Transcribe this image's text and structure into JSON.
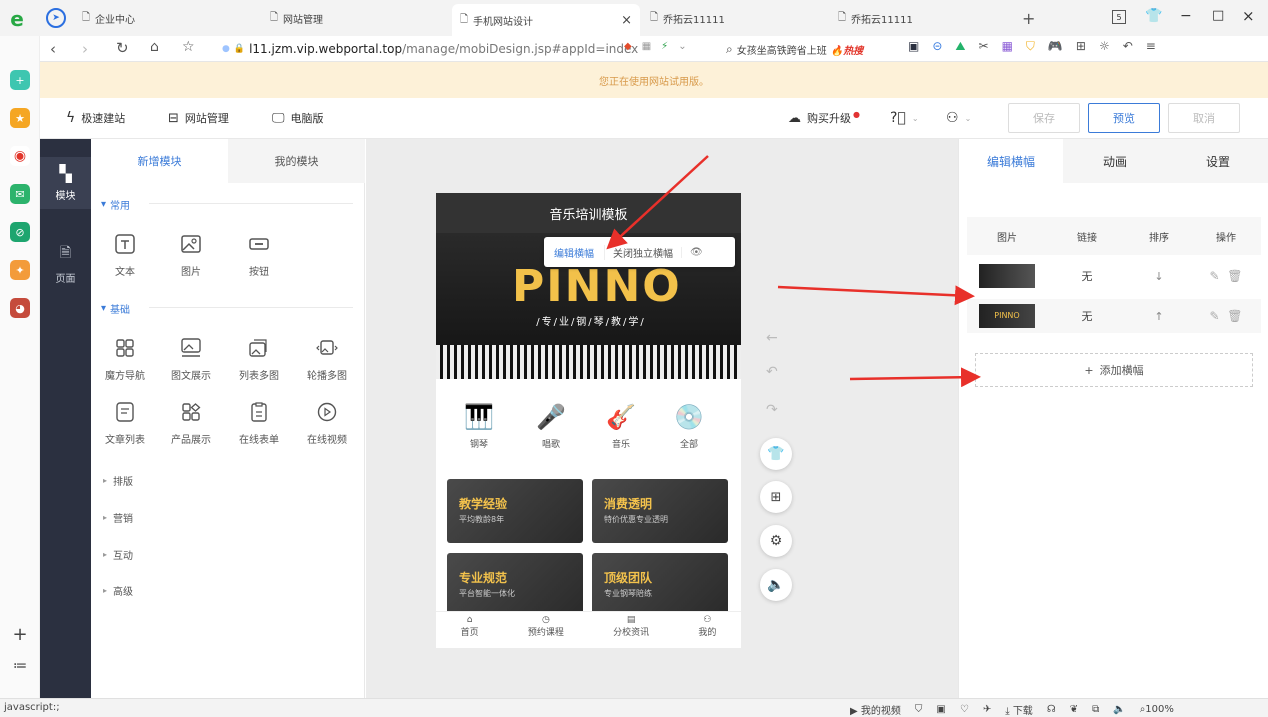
{
  "browser": {
    "tabs": [
      {
        "label": "企业中心"
      },
      {
        "label": "网站管理"
      },
      {
        "label": "手机网站设计",
        "close": "×"
      },
      {
        "label": "乔拓云11111"
      },
      {
        "label": "乔拓云11111"
      }
    ],
    "new_tab": "+",
    "window_controls": [
      "5",
      "−",
      "□",
      "×"
    ],
    "url_domain": "l11.jzm.vip.webportal.top",
    "url_path": "/manage/mobiDesign.jsp#appId=index",
    "search_text": "女孩坐高铁跨省上班",
    "hot_label": "热搜",
    "notice": "您正在使用网站试用版。"
  },
  "toolbar": {
    "items": [
      "极速建站",
      "网站管理",
      "电脑版"
    ],
    "buy": "购买升级",
    "save": "保存",
    "preview": "预览",
    "cancel": "取消"
  },
  "leftnav": {
    "items": [
      {
        "label": "模块"
      },
      {
        "label": "页面"
      }
    ]
  },
  "modules": {
    "tabs": [
      "新增模块",
      "我的模块"
    ],
    "sections": [
      {
        "title": "常用",
        "items": [
          "文本",
          "图片",
          "按钮"
        ]
      },
      {
        "title": "基础",
        "items": [
          "魔方导航",
          "图文展示",
          "列表多图",
          "轮播多图",
          "文章列表",
          "产品展示",
          "在线表单",
          "在线视频"
        ]
      }
    ],
    "categories": [
      "排版",
      "营销",
      "互动",
      "高级"
    ]
  },
  "phone": {
    "title": "音乐培训模板",
    "banner_popup": {
      "edit": "编辑横幅",
      "close": "关闭独立横幅"
    },
    "logo": "PINNO",
    "slogan": "/专/业/钢/琴/教/学/",
    "categories": [
      "钢琴",
      "唱歌",
      "音乐",
      "全部"
    ],
    "cards": [
      {
        "title": "教学经验",
        "sub": "平均教龄8年"
      },
      {
        "title": "消费透明",
        "sub": "特价优惠专业透明"
      },
      {
        "title": "专业规范",
        "sub": "平台智能一体化"
      },
      {
        "title": "顶级团队",
        "sub": "专业钢琴陪练"
      }
    ],
    "bottom_nav": [
      "首页",
      "预约课程",
      "分校资讯",
      "我的"
    ]
  },
  "right_panel": {
    "tabs": [
      "编辑横幅",
      "动画",
      "设置"
    ],
    "columns": [
      "图片",
      "链接",
      "排序",
      "操作"
    ],
    "rows": [
      {
        "link": "无",
        "sort": "↓"
      },
      {
        "link": "无",
        "sort": "↑"
      }
    ],
    "add": "添加横幅"
  },
  "statusbar": {
    "left": "javascript:;",
    "my_video": "我的视频",
    "download": "下载",
    "zoom": "100%"
  }
}
